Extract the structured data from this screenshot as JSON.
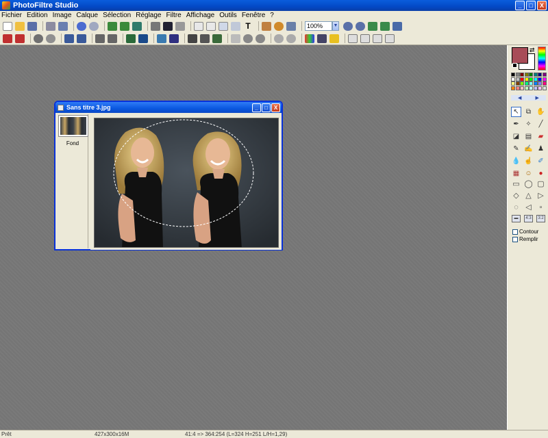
{
  "app": {
    "title": "PhotoFiltre Studio",
    "buttons": {
      "minimize": "_",
      "maximize": "□",
      "close": "X"
    }
  },
  "menu": [
    "Fichier",
    "Edition",
    "Image",
    "Calque",
    "Sélection",
    "Réglage",
    "Filtre",
    "Affichage",
    "Outils",
    "Fenêtre",
    "?"
  ],
  "toolbar": {
    "zoom_value": "100%"
  },
  "document": {
    "title": "Sans titre 3.jpg",
    "layer_name": "Fond"
  },
  "sidebar": {
    "foreground_color": "#a84c58",
    "background_color": "#ffffff",
    "options": [
      {
        "label": "Contour",
        "checked": false
      },
      {
        "label": "Remplir",
        "checked": false
      }
    ],
    "ratio_buttons": [
      "4:3",
      "3:2"
    ]
  },
  "status": {
    "state": "Prêt",
    "dimensions": "427x300x16M",
    "position": "41:4 => 364:254 (L=324  H=251  L/H=1,29)"
  }
}
